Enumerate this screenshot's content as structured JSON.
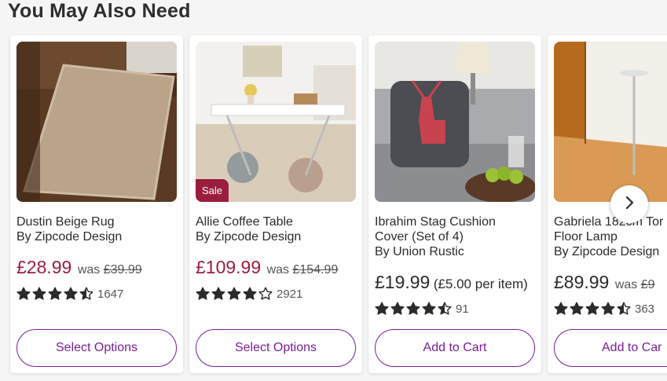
{
  "section": {
    "title": "You May Also Need"
  },
  "products": [
    {
      "title_lines": [
        "Dustin Beige Rug",
        "By Zipcode Design"
      ],
      "price": "£28.99",
      "was_label": "was",
      "was_price": "£39.99",
      "stars": 4.5,
      "review_count": "1647",
      "button": "Select Options",
      "badge": "",
      "image": "rug-photo"
    },
    {
      "title_lines": [
        "Allie Coffee Table",
        "By Zipcode Design"
      ],
      "price": "£109.99",
      "was_label": "was",
      "was_price": "£154.99",
      "stars": 4,
      "review_count": "2921",
      "button": "Select Options",
      "badge": "Sale",
      "image": "coffee-table-photo"
    },
    {
      "title_lines": [
        "Ibrahim Stag Cushion",
        "Cover (Set of 4)",
        "By Union Rustic"
      ],
      "price": "£19.99",
      "per_item": "(£5.00 per item)",
      "stars": 4.5,
      "review_count": "91",
      "button": "Add to Cart",
      "badge": "",
      "image": "stag-cushion-photo"
    },
    {
      "title_lines": [
        "Gabriela 182cm Tor",
        "Floor Lamp",
        "By Zipcode Design"
      ],
      "price": "£89.99",
      "was_label": "was",
      "was_price": "£9",
      "stars": 4.5,
      "review_count": "363",
      "button": "Add to Car",
      "badge": "",
      "image": "floor-lamp-photo"
    }
  ],
  "carousel": {
    "next_icon": "chevron-right-icon"
  },
  "colors": {
    "sale_price": "#9b1d3e",
    "button_accent": "#7a1d9a",
    "star": "#2b2b2b"
  }
}
